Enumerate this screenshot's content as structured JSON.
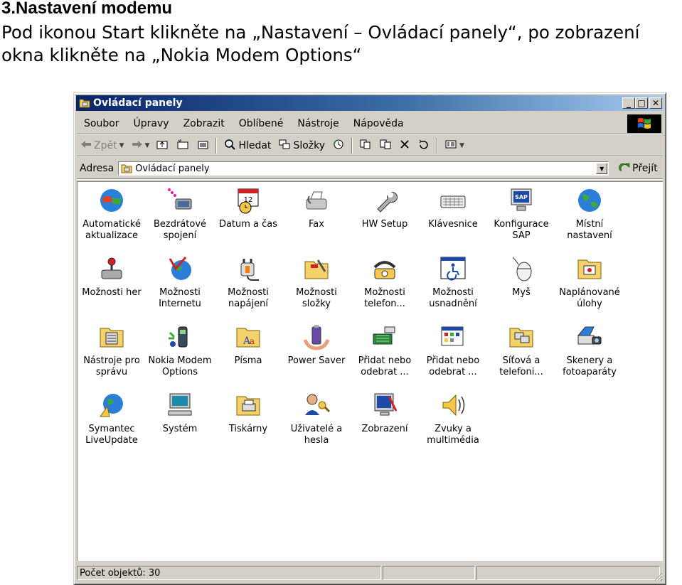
{
  "document": {
    "heading": "3.Nastavení modemu",
    "paragraph": "Pod ikonou Start klikněte na „Nastavení – Ovládací panely“, po zobrazení okna klikněte na „Nokia Modem Options“"
  },
  "window": {
    "title": "Ovládací panely",
    "controls": {
      "minimize": "_",
      "maximize": "□",
      "close": "✕"
    },
    "menu": [
      "Soubor",
      "Úpravy",
      "Zobrazit",
      "Oblíbené",
      "Nástroje",
      "Nápověda"
    ],
    "toolbar": {
      "back": "Zpět",
      "search": "Hledat",
      "folders": "Složky"
    },
    "address": {
      "label": "Adresa",
      "value": "Ovládací panely",
      "go": "Přejít"
    },
    "items": [
      {
        "label": "Automatické aktualizace",
        "icon": "windows-update-icon"
      },
      {
        "label": "Bezdrátové spojení",
        "icon": "wireless-link-icon"
      },
      {
        "label": "Datum a čas",
        "icon": "calendar-clock-icon"
      },
      {
        "label": "Fax",
        "icon": "fax-icon"
      },
      {
        "label": "HW Setup",
        "icon": "wrench-icon"
      },
      {
        "label": "Klávesnice",
        "icon": "keyboard-icon"
      },
      {
        "label": "Konfigurace SAP",
        "icon": "sap-monitor-icon"
      },
      {
        "label": "Místní nastavení",
        "icon": "globe-icon"
      },
      {
        "label": "Možnosti her",
        "icon": "joystick-icon"
      },
      {
        "label": "Možnosti Internetu",
        "icon": "internet-globe-icon"
      },
      {
        "label": "Možnosti napájení",
        "icon": "power-plug-icon"
      },
      {
        "label": "Možnosti složky",
        "icon": "folder-tools-icon"
      },
      {
        "label": "Možnosti telefon...",
        "icon": "telephone-icon"
      },
      {
        "label": "Možnosti usnadnění",
        "icon": "accessibility-icon"
      },
      {
        "label": "Myš",
        "icon": "mouse-icon"
      },
      {
        "label": "Naplánované úlohy",
        "icon": "scheduled-folder-icon"
      },
      {
        "label": "Nástroje pro správu",
        "icon": "admin-tools-icon"
      },
      {
        "label": "Nokia Modem Options",
        "icon": "nokia-modem-icon"
      },
      {
        "label": "Písma",
        "icon": "fonts-folder-icon"
      },
      {
        "label": "Power Saver",
        "icon": "battery-hands-icon"
      },
      {
        "label": "Přidat nebo odebrat ...",
        "icon": "add-hardware-icon"
      },
      {
        "label": "Přidat nebo odebrat ...",
        "icon": "add-programs-icon"
      },
      {
        "label": "Síťová a telefoni...",
        "icon": "network-folder-icon"
      },
      {
        "label": "Skenery a fotoaparáty",
        "icon": "scanner-camera-icon"
      },
      {
        "label": "Symantec LiveUpdate",
        "icon": "live-update-icon"
      },
      {
        "label": "Systém",
        "icon": "computer-icon"
      },
      {
        "label": "Tiskárny",
        "icon": "printer-folder-icon"
      },
      {
        "label": "Uživatelé a hesla",
        "icon": "users-key-icon"
      },
      {
        "label": "Zobrazení",
        "icon": "display-icon"
      },
      {
        "label": "Zvuky a multimédia",
        "icon": "speaker-icon"
      }
    ],
    "status": "Počet objektů: 30"
  }
}
